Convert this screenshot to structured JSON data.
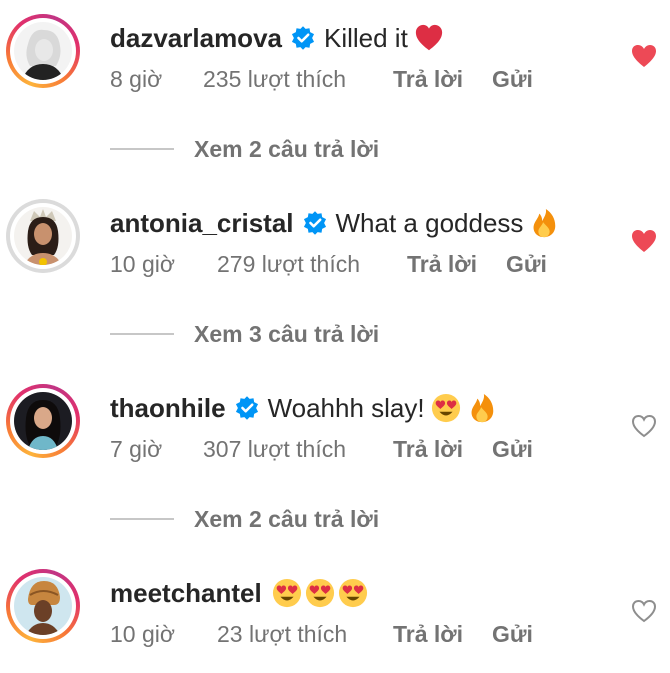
{
  "comments": [
    {
      "username": "dazvarlamova",
      "text": "Killed it",
      "emojis": [
        "red-heart"
      ],
      "time": "8 giờ",
      "likes": "235 lượt thích",
      "reply": "Trả lời",
      "send": "Gửi",
      "liked": true,
      "view_replies": "Xem 2 câu trả lời"
    },
    {
      "username": "antonia_cristal",
      "text": "What a goddess",
      "emojis": [
        "fire"
      ],
      "time": "10 giờ",
      "likes": "279 lượt thích",
      "reply": "Trả lời",
      "send": "Gửi",
      "liked": true,
      "view_replies": "Xem 3 câu trả lời"
    },
    {
      "username": "thaonhile",
      "text": "Woahhh slay!",
      "emojis": [
        "heart-eyes",
        "fire"
      ],
      "time": "7 giờ",
      "likes": "307 lượt thích",
      "reply": "Trả lời",
      "send": "Gửi",
      "liked": false,
      "view_replies": "Xem 2 câu trả lời"
    },
    {
      "username": "meetchantel",
      "text": "",
      "emojis": [
        "heart-eyes",
        "heart-eyes",
        "heart-eyes"
      ],
      "time": "10 giờ",
      "likes": "23 lượt thích",
      "reply": "Trả lời",
      "send": "Gửi",
      "liked": false
    }
  ],
  "colors": {
    "liked_heart": "#ed4956",
    "unliked_heart": "#8e8e8e",
    "verified": "#0095f6",
    "meta_text": "#737373",
    "username": "#262626"
  }
}
